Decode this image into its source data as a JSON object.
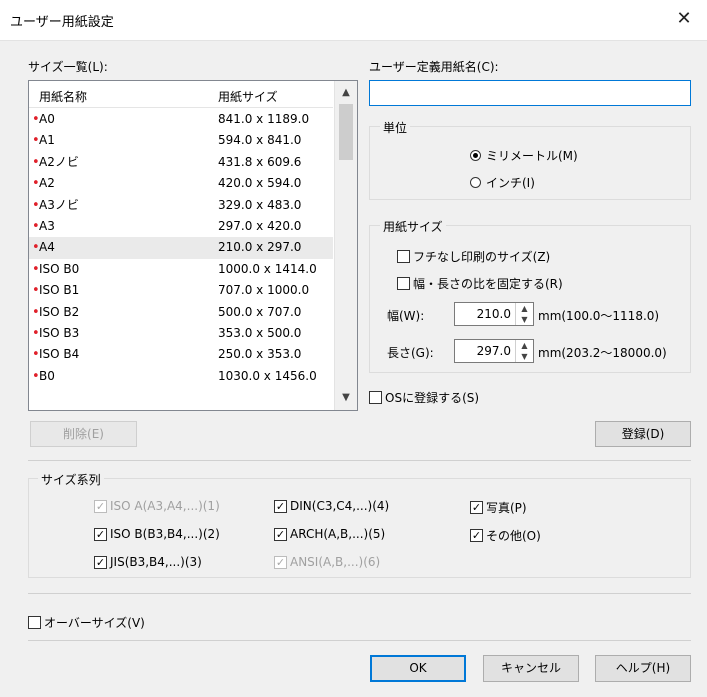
{
  "window": {
    "title": "ユーザー用紙設定",
    "close_icon": "close-icon"
  },
  "size_list": {
    "label": "サイズ一覧(L):",
    "columns": [
      "用紙名称",
      "用紙サイズ"
    ],
    "rows": [
      {
        "name": "A0",
        "size": "841.0 x 1189.0"
      },
      {
        "name": "A1",
        "size": "594.0 x 841.0"
      },
      {
        "name": "A2ノビ",
        "size": "431.8 x 609.6"
      },
      {
        "name": "A2",
        "size": "420.0 x 594.0"
      },
      {
        "name": "A3ノビ",
        "size": "329.0 x 483.0"
      },
      {
        "name": "A3",
        "size": "297.0 x 420.0"
      },
      {
        "name": "A4",
        "size": "210.0 x 297.0",
        "selected": true
      },
      {
        "name": "ISO B0",
        "size": "1000.0 x 1414.0"
      },
      {
        "name": "ISO B1",
        "size": "707.0 x 1000.0"
      },
      {
        "name": "ISO B2",
        "size": "500.0 x 707.0"
      },
      {
        "name": "ISO B3",
        "size": "353.0 x 500.0"
      },
      {
        "name": "ISO B4",
        "size": "250.0 x 353.0"
      },
      {
        "name": "B0",
        "size": "1030.0 x 1456.0"
      }
    ],
    "delete_button": "削除(E)"
  },
  "user_name": {
    "label": "ユーザー定義用紙名(C):",
    "value": ""
  },
  "unit": {
    "title": "単位",
    "mm": "ミリメートル(M)",
    "inch": "インチ(I)",
    "selected": "mm"
  },
  "paper_size": {
    "title": "用紙サイズ",
    "borderless": "フチなし印刷のサイズ(Z)",
    "fix_ratio": "幅・長さの比を固定する(R)",
    "width_label": "幅(W):",
    "width_value": "210.0",
    "width_range": "mm(100.0～1118.0)",
    "length_label": "長さ(G):",
    "length_value": "297.0",
    "length_range": "mm(203.2～18000.0)"
  },
  "os_register": "OSに登録する(S)",
  "register_button": "登録(D)",
  "size_series": {
    "title": "サイズ系列",
    "items": [
      {
        "label": "ISO A(A3,A4,...)(1)",
        "checked": true,
        "enabled": false
      },
      {
        "label": "DIN(C3,C4,...)(4)",
        "checked": true,
        "enabled": true
      },
      {
        "label": "写真(P)",
        "checked": true,
        "enabled": true
      },
      {
        "label": "ISO B(B3,B4,...)(2)",
        "checked": true,
        "enabled": true
      },
      {
        "label": "ARCH(A,B,...)(5)",
        "checked": true,
        "enabled": true
      },
      {
        "label": "その他(O)",
        "checked": true,
        "enabled": true
      },
      {
        "label": "JIS(B3,B4,...)(3)",
        "checked": true,
        "enabled": true
      },
      {
        "label": "ANSI(A,B,...)(6)",
        "checked": true,
        "enabled": false
      }
    ]
  },
  "oversize": "オーバーサイズ(V)",
  "buttons": {
    "ok": "OK",
    "cancel": "キャンセル",
    "help": "ヘルプ(H)"
  },
  "colors": {
    "marker": "#e0202a",
    "focus": "#0078d7"
  }
}
